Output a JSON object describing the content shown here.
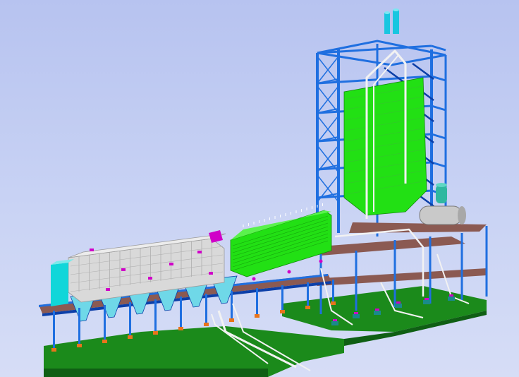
{
  "scene": {
    "kind": "3d-plant-model-render",
    "colors": {
      "background": "#c3cef2",
      "steel": "#1f6fe0",
      "steel_dark": "#0c3fa8",
      "equipment_green": "#22e014",
      "ground": "#1b8a1b",
      "ground_dark": "#0f5f14",
      "pipe_white": "#f2f2f2",
      "casing_grey": "#d9d9d9",
      "cyan_panel": "#11d6d9",
      "walkway": "#8b5a52",
      "accent_magenta": "#d000c8",
      "hopper_cyan": "#6fd8e8",
      "stack_cyan": "#18c6e0",
      "footing_orange": "#e8741c"
    }
  }
}
